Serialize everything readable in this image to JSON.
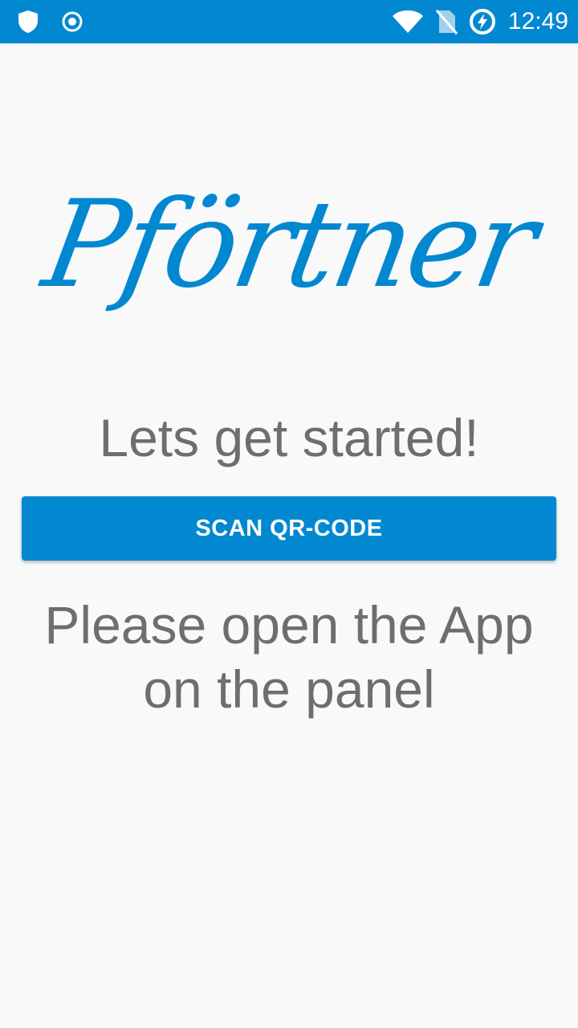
{
  "status_bar": {
    "time": "12:49",
    "icons": [
      "shield-icon",
      "record-icon",
      "wifi-icon",
      "no-sim-icon",
      "battery-charging-icon"
    ],
    "background": "#0288d1"
  },
  "logo": {
    "text": "Pförtner",
    "color": "#0288d1"
  },
  "main": {
    "heading": "Lets get started!",
    "scan_button_label": "SCAN QR-CODE",
    "instruction_line1": "Please open the App",
    "instruction_line2": "on the panel"
  },
  "colors": {
    "accent": "#0288d1",
    "text_gray": "#6e6e6e",
    "background": "#f9f9f9"
  }
}
